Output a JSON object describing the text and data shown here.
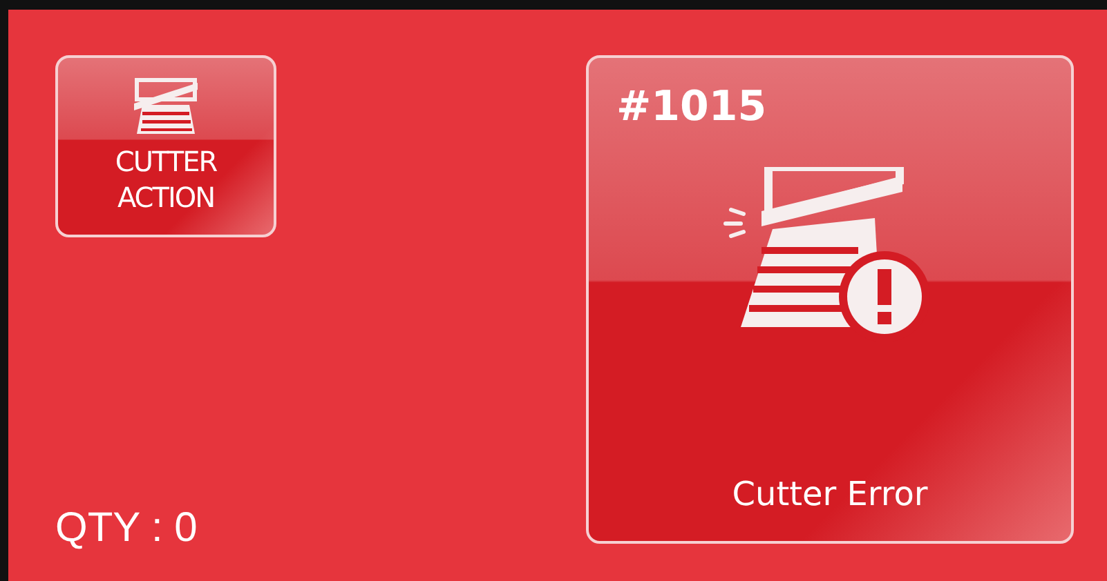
{
  "action_button": {
    "label_lines": [
      "CUTTER",
      "ACTION"
    ]
  },
  "quantity": "QTY : 0",
  "error_card": {
    "code": "#1015",
    "message": "Cutter Error"
  }
}
